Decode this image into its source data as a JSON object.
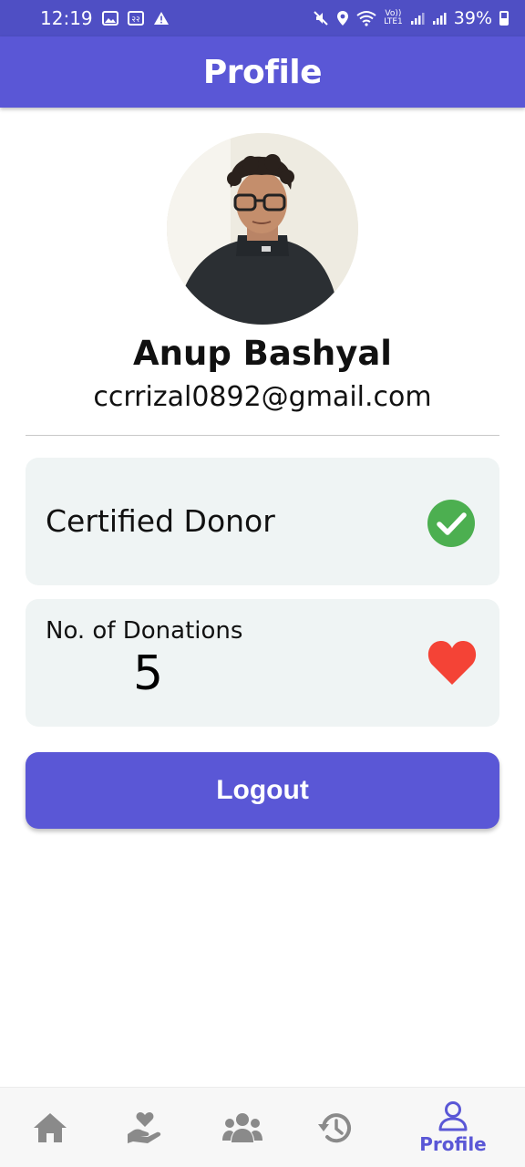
{
  "status_bar": {
    "time": "12:19",
    "battery": "39%",
    "lte_label": "LTE1",
    "volte_label": "Vo))"
  },
  "app_bar": {
    "title": "Profile"
  },
  "profile": {
    "name": "Anup Bashyal",
    "email": "ccrrizal0892@gmail.com"
  },
  "cards": {
    "certified": {
      "label": "Certified Donor",
      "icon": "check-circle-icon",
      "icon_color": "#4caf50"
    },
    "donations": {
      "label": "No. of Donations",
      "count": "5",
      "icon": "heart-icon",
      "icon_color": "#f44336"
    }
  },
  "logout": {
    "label": "Logout"
  },
  "bottom_nav": {
    "items": [
      {
        "icon": "home-icon",
        "label": ""
      },
      {
        "icon": "donate-hand-heart-icon",
        "label": ""
      },
      {
        "icon": "community-icon",
        "label": ""
      },
      {
        "icon": "history-icon",
        "label": ""
      },
      {
        "icon": "profile-icon",
        "label": "Profile",
        "active": true
      }
    ]
  },
  "colors": {
    "primary": "#5a57d6",
    "status_bar": "#4f4fc4",
    "card_bg": "#eff4f4",
    "inactive_icon": "#8a8a8a"
  }
}
